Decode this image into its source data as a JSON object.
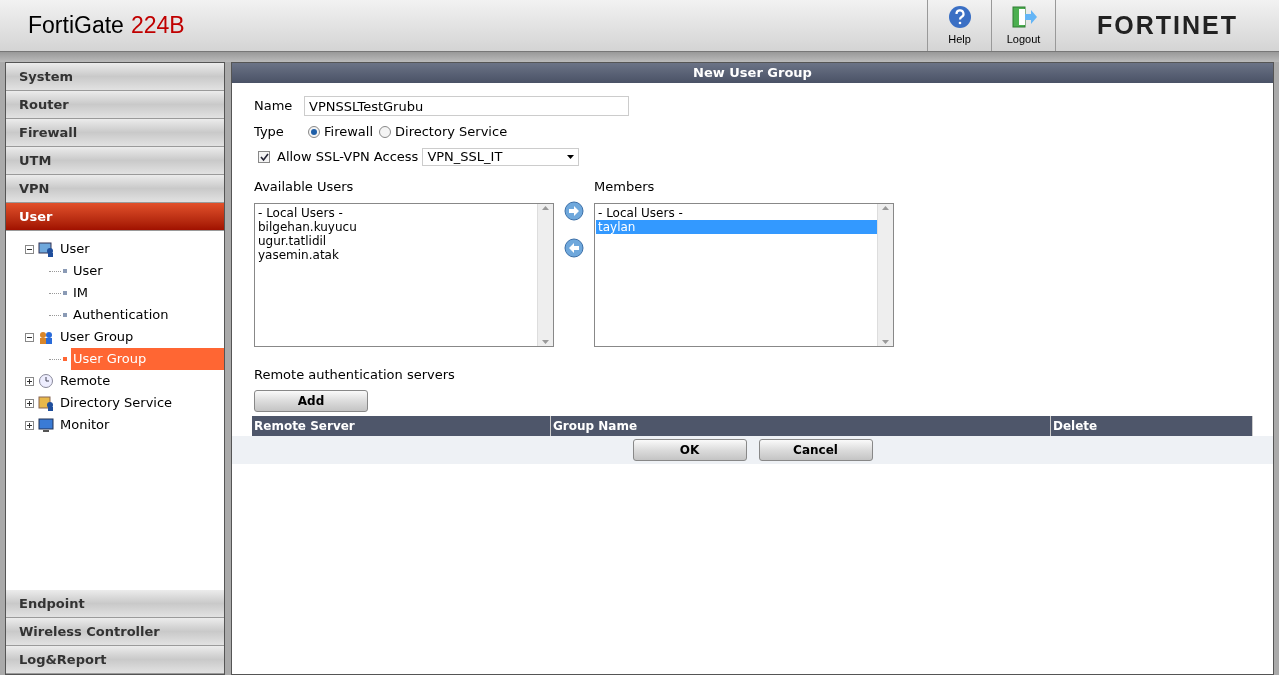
{
  "header": {
    "product": "FortiGate",
    "model": "224B",
    "logo": "FORTINET",
    "buttons": [
      {
        "label": "Help",
        "kind": "help"
      },
      {
        "label": "Logout",
        "kind": "logout"
      }
    ]
  },
  "sidebar": {
    "top_items": [
      {
        "label": "System",
        "selected": false
      },
      {
        "label": "Router",
        "selected": false
      },
      {
        "label": "Firewall",
        "selected": false
      },
      {
        "label": "UTM",
        "selected": false
      },
      {
        "label": "VPN",
        "selected": false
      },
      {
        "label": "User",
        "selected": true
      }
    ],
    "tree": [
      {
        "label": "User",
        "kind": "user",
        "expanded": true,
        "children": [
          {
            "label": "User",
            "selected": false
          },
          {
            "label": "IM",
            "selected": false
          },
          {
            "label": "Authentication",
            "selected": false
          }
        ]
      },
      {
        "label": "User Group",
        "kind": "group",
        "expanded": true,
        "children": [
          {
            "label": "User Group",
            "selected": true
          }
        ]
      },
      {
        "label": "Remote",
        "kind": "remote",
        "expanded": false
      },
      {
        "label": "Directory Service",
        "kind": "directory",
        "expanded": false
      },
      {
        "label": "Monitor",
        "kind": "monitor",
        "expanded": false
      }
    ],
    "bottom_items": [
      {
        "label": "Endpoint",
        "selected": false
      },
      {
        "label": "Wireless Controller",
        "selected": false
      },
      {
        "label": "Log&Report",
        "selected": false
      }
    ]
  },
  "form": {
    "title": "New User Group",
    "name_label": "Name",
    "name_value": "VPNSSLTestGrubu",
    "type_label": "Type",
    "type_options": [
      {
        "label": "Firewall",
        "selected": true
      },
      {
        "label": "Directory Service",
        "selected": false
      }
    ],
    "ssl": {
      "label": "Allow SSL-VPN Access",
      "checked": true,
      "value": "VPN_SSL_IT"
    },
    "available": {
      "label": "Available Users",
      "items": [
        {
          "text": "- Local Users -",
          "selected": false
        },
        {
          "text": "bilgehan.kuyucu",
          "selected": false
        },
        {
          "text": "ugur.tatlidil",
          "selected": false
        },
        {
          "text": "yasemin.atak",
          "selected": false
        }
      ]
    },
    "members": {
      "label": "Members",
      "items": [
        {
          "text": "- Local Users -",
          "selected": false
        },
        {
          "text": "taylan",
          "selected": true
        }
      ]
    },
    "remote_label": "Remote authentication servers",
    "add_button": "Add",
    "table": {
      "columns": [
        "Remote Server",
        "Group Name",
        "Delete"
      ]
    },
    "buttons": [
      "OK",
      "Cancel"
    ]
  }
}
